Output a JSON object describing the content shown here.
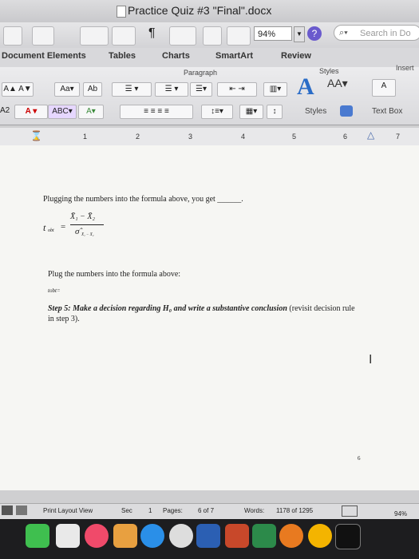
{
  "window": {
    "title": "Practice Quiz #3 \"Final\".docx"
  },
  "toolbar": {
    "zoom": "94%",
    "search_placeholder": "Search in Do",
    "help": "?"
  },
  "ribbon_tabs": [
    "Document Elements",
    "Tables",
    "Charts",
    "SmartArt",
    "Review"
  ],
  "ribbon_groups": {
    "paragraph": "Paragraph",
    "styles": "Styles",
    "insert": "Insert",
    "styles_btn": "Styles",
    "text_box": "Text Box"
  },
  "ruler": {
    "n1": "1",
    "n2": "2",
    "n3": "3",
    "n4": "4",
    "n5": "5",
    "n6": "6",
    "n7": "7"
  },
  "document": {
    "line1": "Plugging the numbers into the formula above, you get ______.",
    "formula_lhs": "t",
    "formula_lhs_sub": "obt",
    "formula_num": "X̄₁ − X̄₂",
    "formula_den": "σ̂",
    "formula_den_sub": "X̄₁ − X̄₂",
    "line2": "Plug the numbers into the formula above:",
    "tobt": "tobt=",
    "step5_bold": "Step 5: Make a decision regarding H₀ and write a substantive conclusion",
    "step5_rest": " (revisit decision rule",
    "step5_line2": "in step 3).",
    "page_number": "6"
  },
  "status": {
    "view": "Print Layout View",
    "sec_label": "Sec",
    "sec_value": "1",
    "pages_label": "Pages:",
    "pages_value": "6 of 7",
    "words_label": "Words:",
    "words_value": "1178 of 1295",
    "zoom": "94%"
  }
}
